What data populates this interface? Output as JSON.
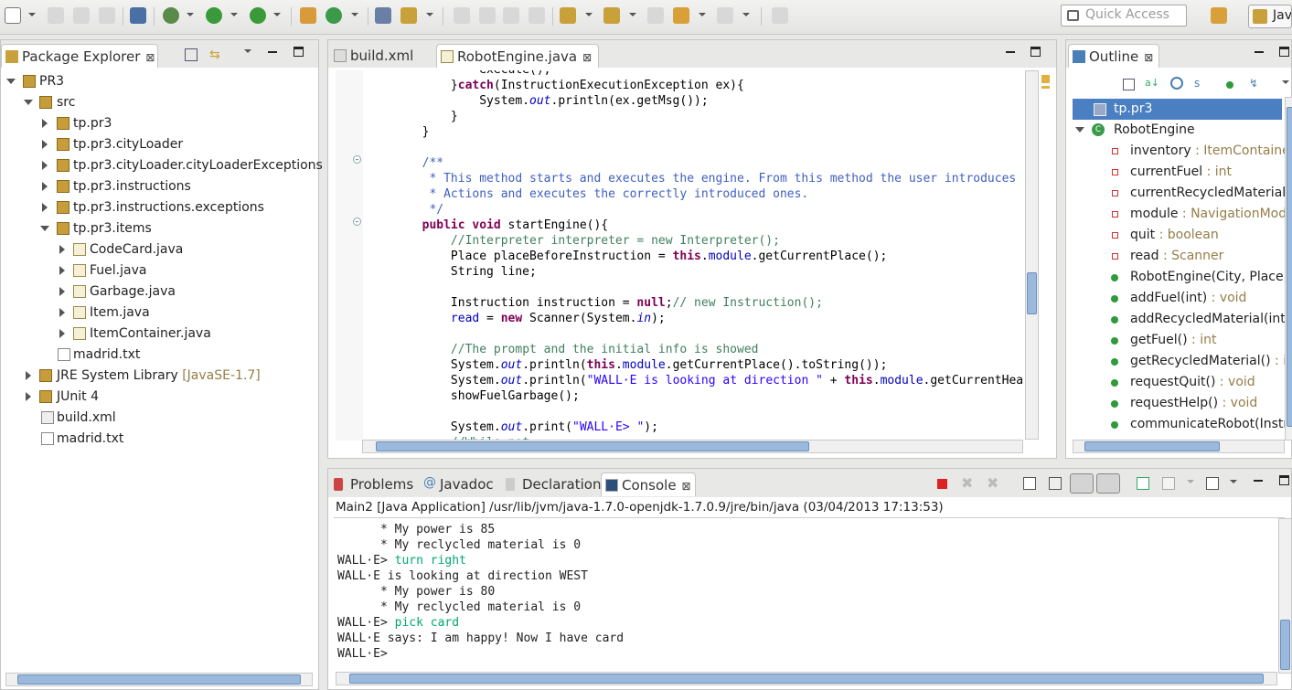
{
  "toolbar": {
    "quick_access_placeholder": "Quick Access",
    "perspective_label": "Java"
  },
  "package_explorer": {
    "title": "Package Explorer",
    "project": "PR3",
    "src": "src",
    "packages": [
      "tp.pr3",
      "tp.pr3.cityLoader",
      "tp.pr3.cityLoader.cityLoaderExceptions",
      "tp.pr3.instructions",
      "tp.pr3.instructions.exceptions",
      "tp.pr3.items"
    ],
    "items_files": [
      "CodeCard.java",
      "Fuel.java",
      "Garbage.java",
      "Item.java",
      "ItemContainer.java"
    ],
    "src_file": "madrid.txt",
    "jre_label": "JRE System Library",
    "jre_version": "[JavaSE-1.7]",
    "junit": "JUnit 4",
    "build_xml": "build.xml",
    "root_file": "madrid.txt"
  },
  "editor": {
    "tabs": [
      "build.xml",
      "RobotEngine.java"
    ],
    "active_tab": "RobotEngine.java"
  },
  "outline": {
    "title": "Outline",
    "package": "tp.pr3",
    "class": "RobotEngine",
    "members": [
      {
        "name": "inventory",
        "type": " : ItemContainer",
        "kind": "field"
      },
      {
        "name": "currentFuel",
        "type": " : int",
        "kind": "field"
      },
      {
        "name": "currentRecycledMaterial",
        "type": " : int",
        "kind": "field"
      },
      {
        "name": "module",
        "type": " : NavigationModule",
        "kind": "field"
      },
      {
        "name": "quit",
        "type": " : boolean",
        "kind": "field"
      },
      {
        "name": "read",
        "type": " : Scanner",
        "kind": "field"
      },
      {
        "name": "RobotEngine(City, Place, Direction)",
        "type": "",
        "kind": "ctor"
      },
      {
        "name": "addFuel(int)",
        "type": " : void",
        "kind": "method"
      },
      {
        "name": "addRecycledMaterial(int)",
        "type": " : void",
        "kind": "method"
      },
      {
        "name": "getFuel()",
        "type": " : int",
        "kind": "method"
      },
      {
        "name": "getRecycledMaterial()",
        "type": " : int",
        "kind": "method"
      },
      {
        "name": "requestQuit()",
        "type": " : void",
        "kind": "method"
      },
      {
        "name": "requestHelp()",
        "type": " : void",
        "kind": "method"
      },
      {
        "name": "communicateRobot(Instruction)",
        "type": "",
        "kind": "method"
      }
    ]
  },
  "bottom": {
    "tabs": [
      "Problems",
      "Javadoc",
      "Declaration",
      "Console"
    ],
    "active_tab": "Console",
    "console_header": "Main2 [Java Application] /usr/lib/jvm/java-1.7.0-openjdk-1.7.0.9/jre/bin/java (03/04/2013 17:13:53)",
    "lines": [
      {
        "text": "      * My power is 85",
        "input": ""
      },
      {
        "text": "      * My reclycled material is 0",
        "input": ""
      },
      {
        "text": "WALL·E> ",
        "input": "turn right"
      },
      {
        "text": "WALL·E is looking at direction WEST",
        "input": ""
      },
      {
        "text": "      * My power is 80",
        "input": ""
      },
      {
        "text": "      * My reclycled material is 0",
        "input": ""
      },
      {
        "text": "WALL·E> ",
        "input": "pick card"
      },
      {
        "text": "WALL·E says: I am happy! Now I have card",
        "input": ""
      },
      {
        "text": "WALL·E>",
        "input": ""
      }
    ]
  },
  "colors": {
    "keyword": "#7f0055",
    "comment": "#3f7f5f",
    "javadoc": "#3f5fbf",
    "string": "#2a00ff",
    "field": "#0000c0",
    "console_input": "#00a870"
  }
}
